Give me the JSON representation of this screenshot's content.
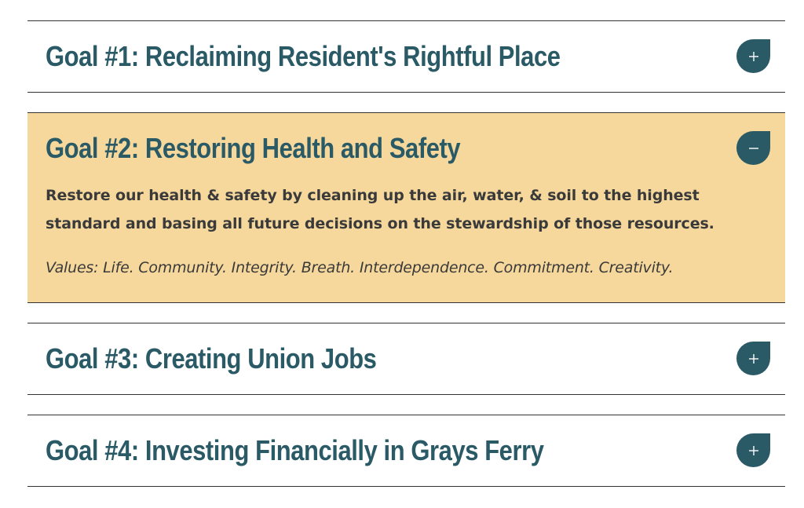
{
  "colors": {
    "accent": "#2a5a66",
    "open_background": "#f6d89c",
    "body_text": "#3a3a3a",
    "divider": "#333333"
  },
  "goals": [
    {
      "title": "Goal #1: Reclaiming Resident's Rightful Place",
      "expanded": false,
      "toggle_icon": "plus-icon"
    },
    {
      "title": "Goal #2: Restoring Health and Safety",
      "expanded": true,
      "toggle_icon": "minus-icon",
      "description": "Restore our health & safety by cleaning up the air, water, & soil to the highest standard and basing all future decisions on the stewardship of those resources.",
      "values": "Values: Life. Community. Integrity. Breath. Interdependence. Commitment. Creativity."
    },
    {
      "title": "Goal #3: Creating Union Jobs",
      "expanded": false,
      "toggle_icon": "plus-icon"
    },
    {
      "title": "Goal #4: Investing Financially in Grays Ferry",
      "expanded": false,
      "toggle_icon": "plus-icon"
    }
  ]
}
